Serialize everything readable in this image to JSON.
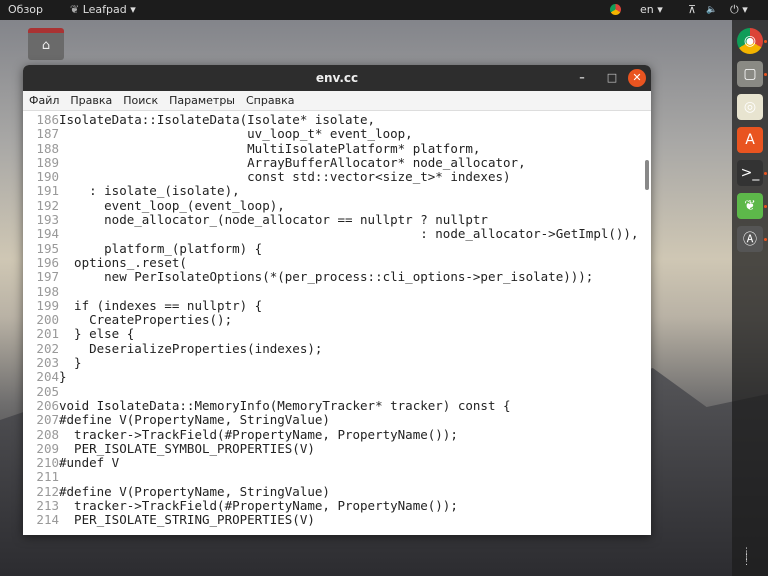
{
  "topbar": {
    "activities": "Обзор",
    "app": "Leafpad",
    "app_arrow": "▾",
    "lang": "en ▾",
    "network": "⊼",
    "volume": "🔈",
    "power": "⏻ ▾"
  },
  "desktop": {
    "home_icon": "⌂"
  },
  "window": {
    "title": "env.cc",
    "minimize": "–",
    "maximize": "□",
    "close": "✕"
  },
  "menu": [
    "Файл",
    "Правка",
    "Поиск",
    "Параметры",
    "Справка"
  ],
  "editor": {
    "lines": [
      {
        "n": "186",
        "t": "IsolateData::IsolateData(Isolate* isolate,"
      },
      {
        "n": "187",
        "t": "                         uv_loop_t* event_loop,"
      },
      {
        "n": "188",
        "t": "                         MultiIsolatePlatform* platform,"
      },
      {
        "n": "189",
        "t": "                         ArrayBufferAllocator* node_allocator,"
      },
      {
        "n": "190",
        "t": "                         const std::vector<size_t>* indexes)"
      },
      {
        "n": "191",
        "t": "    : isolate_(isolate),"
      },
      {
        "n": "192",
        "t": "      event_loop_(event_loop),"
      },
      {
        "n": "193",
        "t": "      node_allocator_(node_allocator == nullptr ? nullptr"
      },
      {
        "n": "194",
        "t": "                                                : node_allocator->GetImpl()),"
      },
      {
        "n": "195",
        "t": "      platform_(platform) {"
      },
      {
        "n": "196",
        "t": "  options_.reset("
      },
      {
        "n": "197",
        "t": "      new PerIsolateOptions(*(per_process::cli_options->per_isolate)));"
      },
      {
        "n": "198",
        "t": ""
      },
      {
        "n": "199",
        "t": "  if (indexes == nullptr) {"
      },
      {
        "n": "200",
        "t": "    CreateProperties();"
      },
      {
        "n": "201",
        "t": "  } else {"
      },
      {
        "n": "202",
        "t": "    DeserializeProperties(indexes);"
      },
      {
        "n": "203",
        "t": "  }"
      },
      {
        "n": "204",
        "t": "}"
      },
      {
        "n": "205",
        "t": ""
      },
      {
        "n": "206",
        "t": "void IsolateData::MemoryInfo(MemoryTracker* tracker) const {"
      },
      {
        "n": "207",
        "t": "#define V(PropertyName, StringValue)"
      },
      {
        "n": "208",
        "t": "  tracker->TrackField(#PropertyName, PropertyName());"
      },
      {
        "n": "209",
        "t": "  PER_ISOLATE_SYMBOL_PROPERTIES(V)"
      },
      {
        "n": "210",
        "t": "#undef V"
      },
      {
        "n": "211",
        "t": ""
      },
      {
        "n": "212",
        "t": "#define V(PropertyName, StringValue)"
      },
      {
        "n": "213",
        "t": "  tracker->TrackField(#PropertyName, PropertyName());"
      },
      {
        "n": "214",
        "t": "  PER_ISOLATE_STRING_PROPERTIES(V)"
      }
    ]
  },
  "dock": [
    {
      "name": "chrome",
      "glyph": "◉",
      "bg": "#db4437",
      "running": true
    },
    {
      "name": "files",
      "glyph": "▢",
      "bg": "#8a8a84",
      "running": true
    },
    {
      "name": "rhythmbox",
      "glyph": "◎",
      "bg": "#e8e4d0",
      "running": false
    },
    {
      "name": "software",
      "glyph": "A",
      "bg": "#e95420",
      "running": false
    },
    {
      "name": "terminal",
      "glyph": ">_",
      "bg": "#333",
      "running": true
    },
    {
      "name": "leafpad",
      "glyph": "❦",
      "bg": "#5db84a",
      "running": true
    },
    {
      "name": "updater",
      "glyph": "Ⓐ",
      "bg": "#555",
      "running": true
    }
  ],
  "app_grid": "⋮⋮⋮"
}
